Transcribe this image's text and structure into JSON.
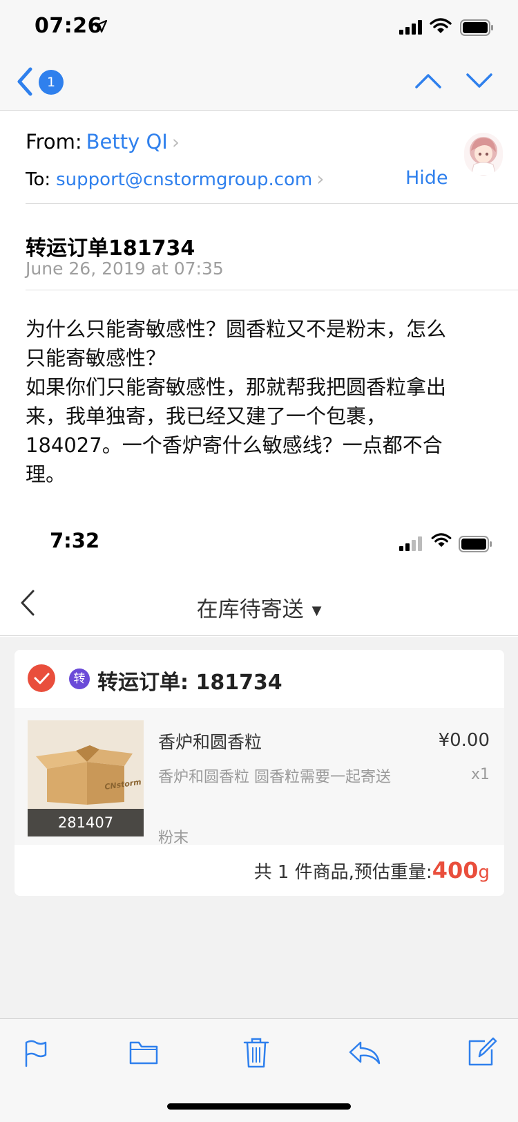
{
  "status_bar": {
    "time": "07:26"
  },
  "mail_nav": {
    "unread_count": "1"
  },
  "header": {
    "from_label": "From:",
    "from_name": "Betty QI",
    "to_label": "To:",
    "to_address": "support@cnstormgroup.com",
    "hide_label": "Hide"
  },
  "message": {
    "subject": "转运订单181734",
    "date": "June 26, 2019 at 07:35",
    "body_lines": [
      "为什么只能寄敏感性？圆香粒又不是粉末，怎么",
      "只能寄敏感性？",
      "如果你们只能寄敏感性，那就帮我把圆香粒拿出",
      "来，我单独寄，我已经又建了一个包裹，",
      "184027。一个香炉寄什么敏感线？一点都不合",
      "理。"
    ]
  },
  "embedded_screenshot": {
    "status_time": "7:32",
    "nav_title": "在库待寄送",
    "order": {
      "type_badge": "转",
      "title": "转运订单: 181734",
      "item_name": "香炉和圆香粒",
      "item_price": "¥0.00",
      "item_desc": "香炉和圆香粒 圆香粒需要一起寄送",
      "item_qty": "x1",
      "item_tag": "粉末",
      "package_id": "281407",
      "box_brand": "CNstorm",
      "summary_prefix": "共 1 件商品,预估重量:",
      "weight_value": "400",
      "weight_unit": "g"
    }
  },
  "colors": {
    "ios_blue": "#2f80ed",
    "accent_red": "#e94e3c",
    "badge_purple": "#6b4bd8"
  },
  "toolbar": {
    "icons": [
      "flag-icon",
      "folder-icon",
      "trash-icon",
      "reply-icon",
      "compose-icon"
    ]
  }
}
